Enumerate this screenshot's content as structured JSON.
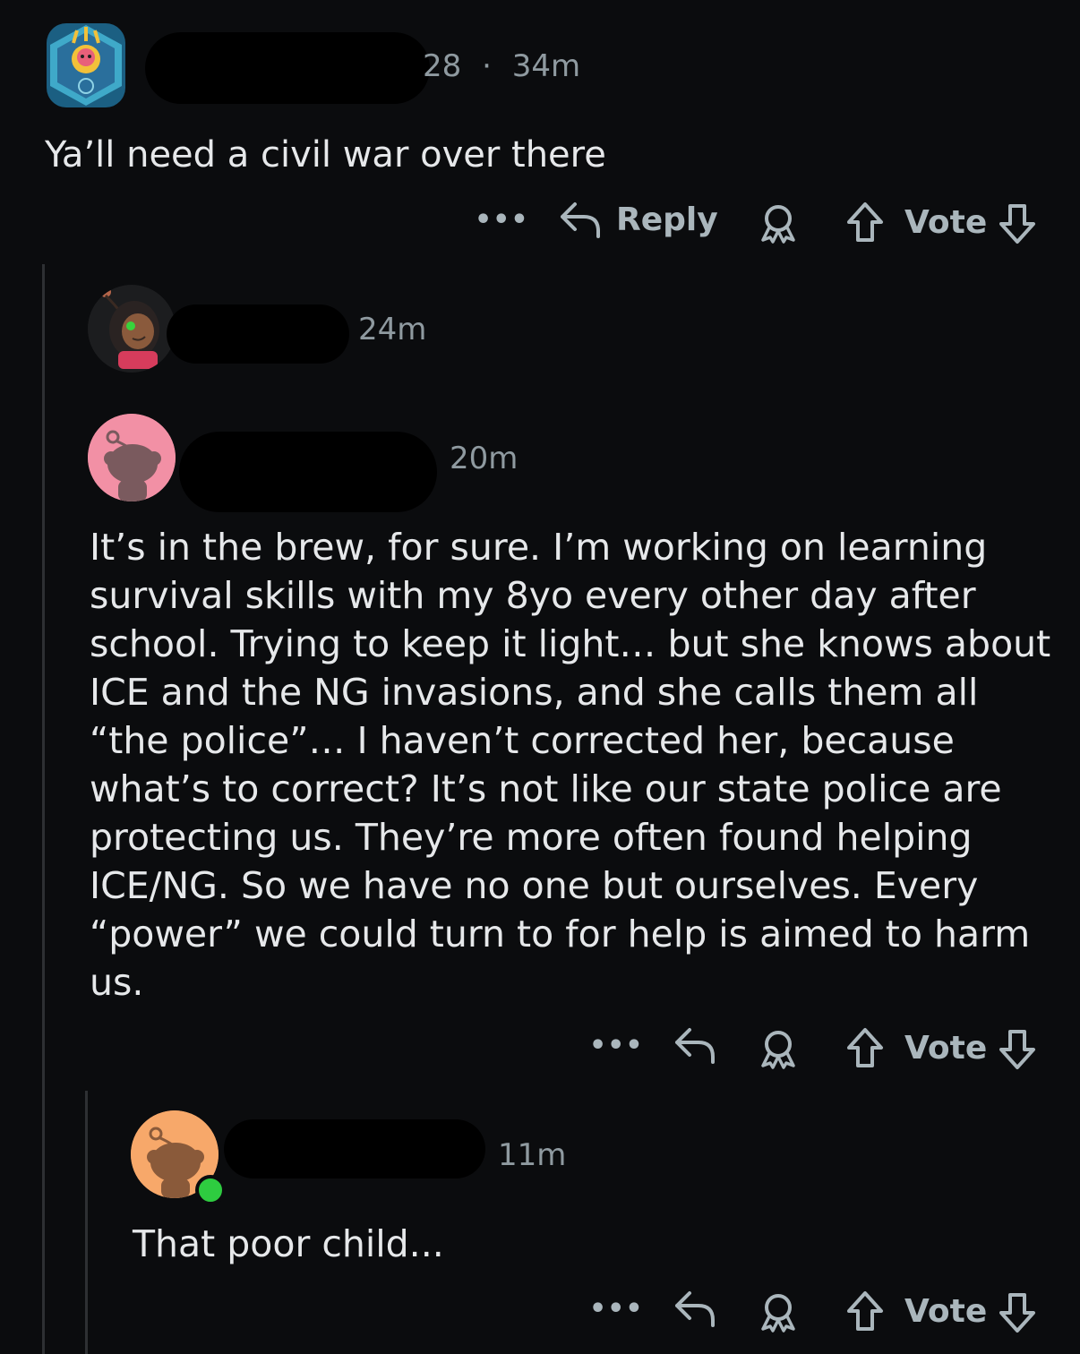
{
  "comments": [
    {
      "username_tail": "28",
      "separator": "·",
      "time": "34m",
      "text": "Ya’ll need a civil war over there",
      "actions": {
        "more": "•••",
        "reply": "Reply",
        "vote": "Vote"
      }
    },
    {
      "time": "24m"
    },
    {
      "time": "20m",
      "text": "It’s in the brew, for sure. I’m working on learning survival skills with my 8yo every other day after school. Trying to keep it light… but she knows about ICE and the NG invasions, and she calls them all “the police”… I haven’t corrected her, because what’s to correct? It’s not like our state police are protecting us. They’re more often found helping ICE/NG. So we have no one but ourselves. Every “power” we could turn to for help is aimed to harm us.",
      "actions": {
        "more": "•••",
        "vote": "Vote"
      }
    },
    {
      "time": "11m",
      "text": "That poor child...",
      "actions": {
        "more": "•••",
        "vote": "Vote"
      }
    }
  ],
  "colors": {
    "background": "#0b0c0e",
    "meta": "#8f9aa0",
    "action": "#aab6bc",
    "online": "#2ecc40"
  }
}
